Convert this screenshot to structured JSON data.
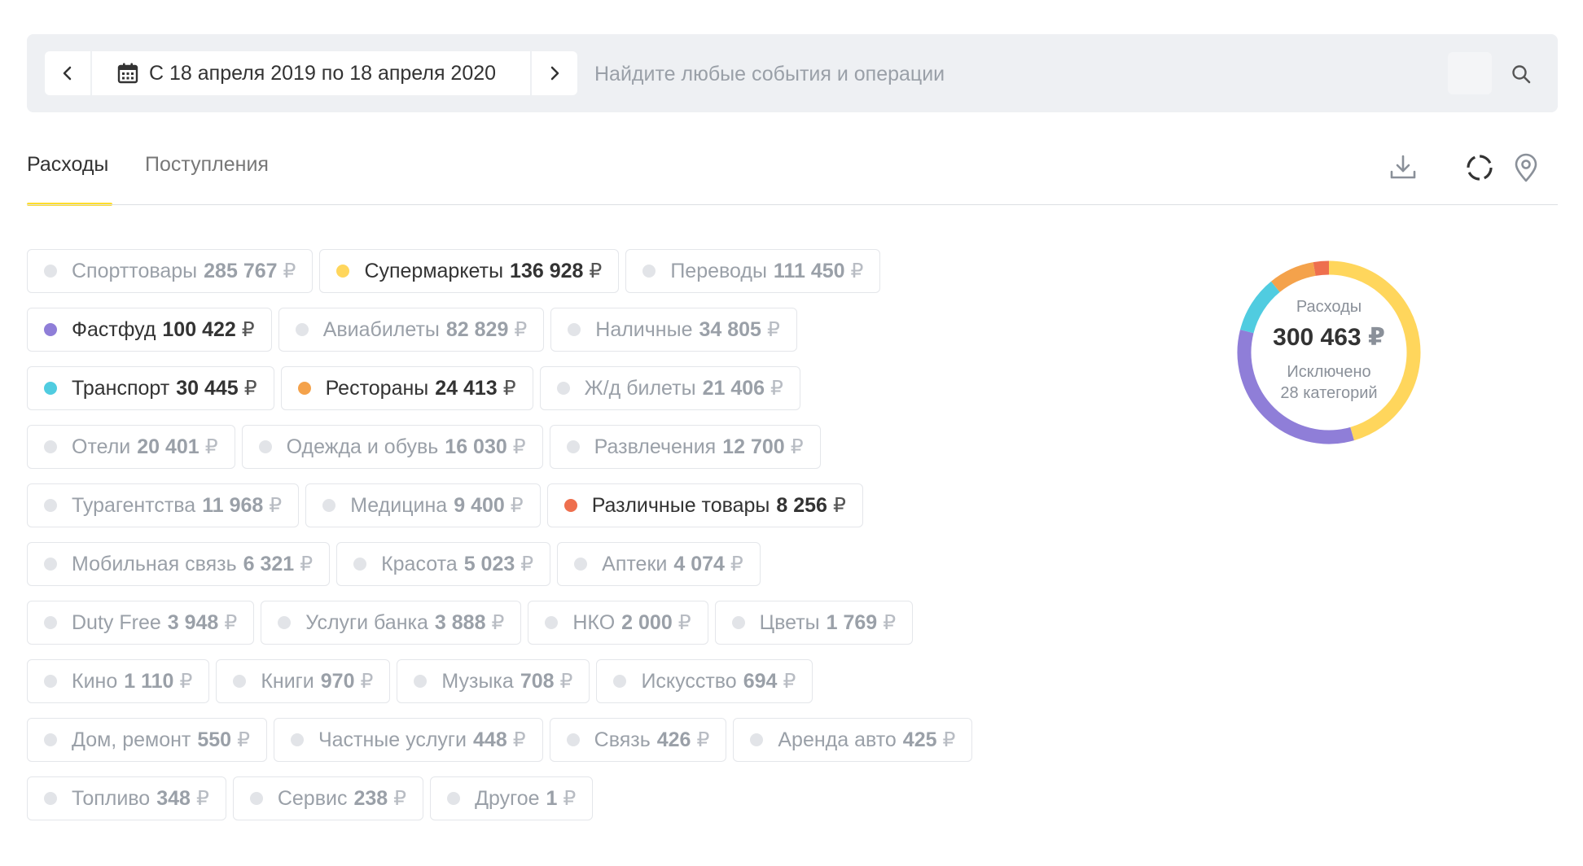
{
  "period": {
    "label": "С 18 апреля 2019 по 18 апреля 2020"
  },
  "search": {
    "placeholder": "Найдите любые события и операции"
  },
  "tabs": {
    "expenses": "Расходы",
    "income": "Поступления"
  },
  "currency": "₽",
  "categories": [
    [
      {
        "name": "Спорттовары",
        "amount": "285 767",
        "active": false,
        "color": "#e2e4e8"
      },
      {
        "name": "Супермаркеты",
        "amount": "136 928",
        "active": true,
        "color": "#ffd65c"
      },
      {
        "name": "Переводы",
        "amount": "111 450",
        "active": false,
        "color": "#e2e4e8"
      }
    ],
    [
      {
        "name": "Фастфуд",
        "amount": "100 422",
        "active": true,
        "color": "#8f7ed8"
      },
      {
        "name": "Авиабилеты",
        "amount": "82 829",
        "active": false,
        "color": "#e2e4e8"
      },
      {
        "name": "Наличные",
        "amount": "34 805",
        "active": false,
        "color": "#e2e4e8"
      }
    ],
    [
      {
        "name": "Транспорт",
        "amount": "30 445",
        "active": true,
        "color": "#50cce0"
      },
      {
        "name": "Рестораны",
        "amount": "24 413",
        "active": true,
        "color": "#f4a24b"
      },
      {
        "name": "Ж/д билеты",
        "amount": "21 406",
        "active": false,
        "color": "#e2e4e8"
      }
    ],
    [
      {
        "name": "Отели",
        "amount": "20 401",
        "active": false,
        "color": "#e2e4e8"
      },
      {
        "name": "Одежда и обувь",
        "amount": "16 030",
        "active": false,
        "color": "#e2e4e8"
      },
      {
        "name": "Развлечения",
        "amount": "12 700",
        "active": false,
        "color": "#e2e4e8"
      }
    ],
    [
      {
        "name": "Турагентства",
        "amount": "11 968",
        "active": false,
        "color": "#e2e4e8"
      },
      {
        "name": "Медицина",
        "amount": "9 400",
        "active": false,
        "color": "#e2e4e8"
      },
      {
        "name": "Различные товары",
        "amount": "8 256",
        "active": true,
        "color": "#ee6f4e"
      }
    ],
    [
      {
        "name": "Мобильная связь",
        "amount": "6 321",
        "active": false,
        "color": "#e2e4e8"
      },
      {
        "name": "Красота",
        "amount": "5 023",
        "active": false,
        "color": "#e2e4e8"
      },
      {
        "name": "Аптеки",
        "amount": "4 074",
        "active": false,
        "color": "#e2e4e8"
      }
    ],
    [
      {
        "name": "Duty Free",
        "amount": "3 948",
        "active": false,
        "color": "#e2e4e8"
      },
      {
        "name": "Услуги банка",
        "amount": "3 888",
        "active": false,
        "color": "#e2e4e8"
      },
      {
        "name": "НКО",
        "amount": "2 000",
        "active": false,
        "color": "#e2e4e8"
      },
      {
        "name": "Цветы",
        "amount": "1 769",
        "active": false,
        "color": "#e2e4e8"
      }
    ],
    [
      {
        "name": "Кино",
        "amount": "1 110",
        "active": false,
        "color": "#e2e4e8"
      },
      {
        "name": "Книги",
        "amount": "970",
        "active": false,
        "color": "#e2e4e8"
      },
      {
        "name": "Музыка",
        "amount": "708",
        "active": false,
        "color": "#e2e4e8"
      },
      {
        "name": "Искусство",
        "amount": "694",
        "active": false,
        "color": "#e2e4e8"
      }
    ],
    [
      {
        "name": "Дом, ремонт",
        "amount": "550",
        "active": false,
        "color": "#e2e4e8"
      },
      {
        "name": "Частные услуги",
        "amount": "448",
        "active": false,
        "color": "#e2e4e8"
      },
      {
        "name": "Связь",
        "amount": "426",
        "active": false,
        "color": "#e2e4e8"
      },
      {
        "name": "Аренда авто",
        "amount": "425",
        "active": false,
        "color": "#e2e4e8"
      }
    ],
    [
      {
        "name": "Топливо",
        "amount": "348",
        "active": false,
        "color": "#e2e4e8"
      },
      {
        "name": "Сервис",
        "amount": "238",
        "active": false,
        "color": "#e2e4e8"
      },
      {
        "name": "Другое",
        "amount": "1",
        "active": false,
        "color": "#e2e4e8"
      }
    ]
  ],
  "summary": {
    "label": "Расходы",
    "total": "300 463",
    "excluded_line1": "Исключено",
    "excluded_line2": "28 категорий"
  },
  "donut_segments": [
    {
      "category": "Супермаркеты",
      "value": 136928,
      "color": "#ffd65c"
    },
    {
      "category": "Фастфуд",
      "value": 100422,
      "color": "#8f7ed8"
    },
    {
      "category": "Транспорт",
      "value": 30445,
      "color": "#50cce0"
    },
    {
      "category": "Рестораны",
      "value": 24413,
      "color": "#f4a24b"
    },
    {
      "category": "Различные товары",
      "value": 8256,
      "color": "#ee6f4e"
    }
  ]
}
